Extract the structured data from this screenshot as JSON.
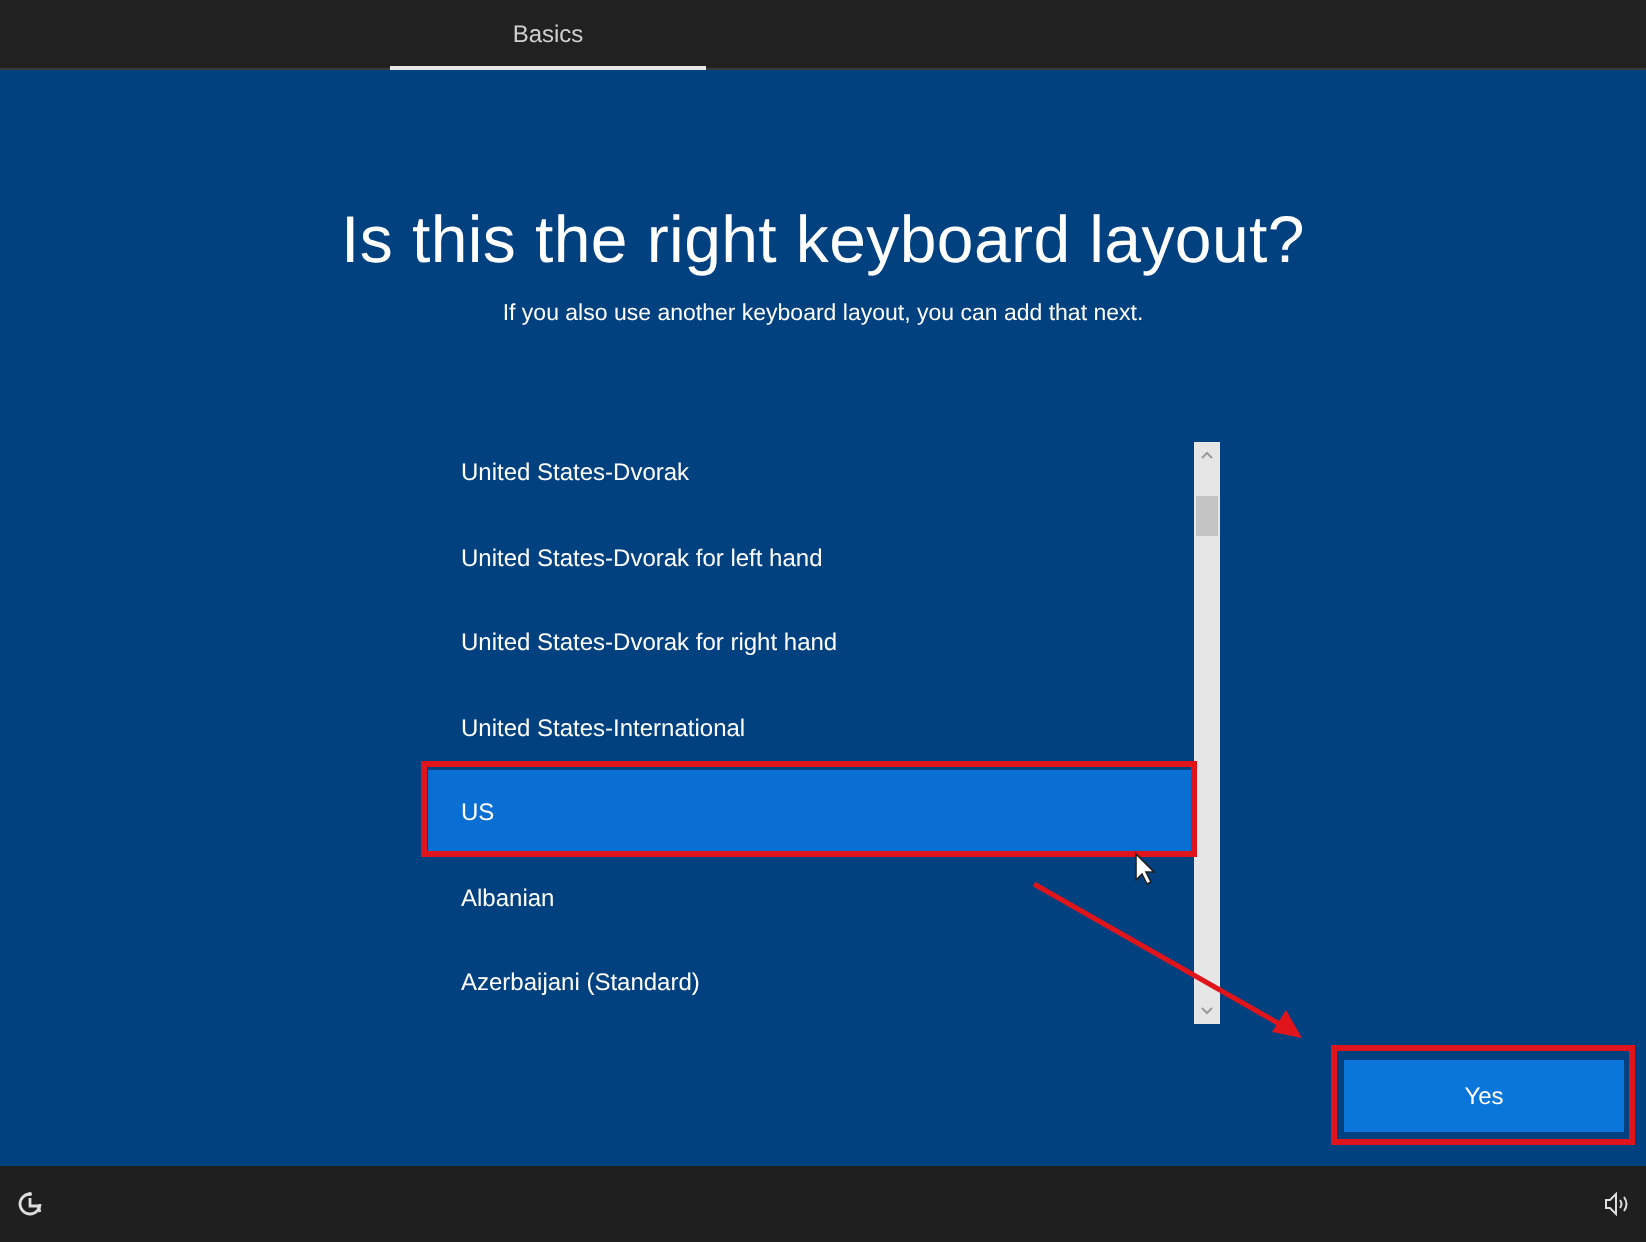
{
  "tabs": [
    {
      "label": "Basics",
      "selected": true
    }
  ],
  "heading": "Is this the right keyboard layout?",
  "subheading": "If you also use another keyboard layout, you can add that next.",
  "layouts": [
    {
      "label": "United States-Dvorak",
      "selected": false
    },
    {
      "label": "United States-Dvorak for left hand",
      "selected": false
    },
    {
      "label": "United States-Dvorak for right hand",
      "selected": false
    },
    {
      "label": "United States-International",
      "selected": false
    },
    {
      "label": "US",
      "selected": true
    },
    {
      "label": "Albanian",
      "selected": false
    },
    {
      "label": "Azerbaijani (Standard)",
      "selected": false
    }
  ],
  "confirm_button": "Yes"
}
